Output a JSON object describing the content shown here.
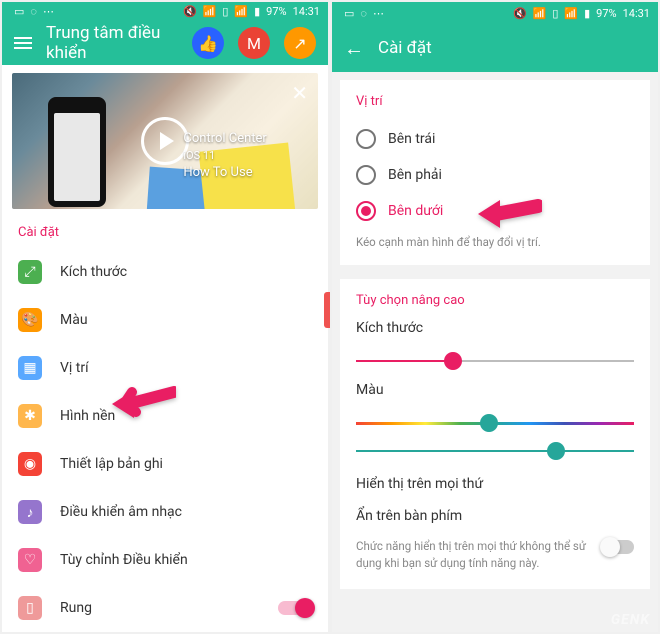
{
  "status": {
    "battery": "97%",
    "time": "14:31"
  },
  "left": {
    "title": "Trung tâm điều khiển",
    "video": {
      "t1": "Control Center",
      "t2": "iOS 11",
      "t3": "How To Use"
    },
    "section": "Cài đặt",
    "items": [
      {
        "label": "Kích thước",
        "icon": "expand-icon"
      },
      {
        "label": "Màu",
        "icon": "palette-icon"
      },
      {
        "label": "Vị trí",
        "icon": "grid-icon"
      },
      {
        "label": "Hình nền",
        "icon": "image-icon"
      },
      {
        "label": "Thiết lập bản ghi",
        "icon": "record-icon"
      },
      {
        "label": "Điều khiển âm nhạc",
        "icon": "music-icon"
      },
      {
        "label": "Tùy chỉnh Điều khiển",
        "icon": "heart-icon"
      },
      {
        "label": "Rung",
        "icon": "vibrate-icon"
      }
    ]
  },
  "right": {
    "title": "Cài đặt",
    "position": {
      "title": "Vị trí",
      "options": [
        {
          "label": "Bên trái",
          "selected": false
        },
        {
          "label": "Bên phải",
          "selected": false
        },
        {
          "label": "Bên dưới",
          "selected": true
        }
      ],
      "hint": "Kéo cạnh màn hình để thay đổi vị trí."
    },
    "advanced": {
      "title": "Tùy chọn nâng cao",
      "size_label": "Kích thước",
      "color_label": "Màu",
      "overlay_label": "Hiển thị trên mọi thứ",
      "hide_kb_label": "Ẩn trên bàn phím",
      "hide_kb_desc": "Chức năng hiển thị trên mọi thứ không thể sử dụng khi bạn sử dụng tính năng này."
    }
  }
}
